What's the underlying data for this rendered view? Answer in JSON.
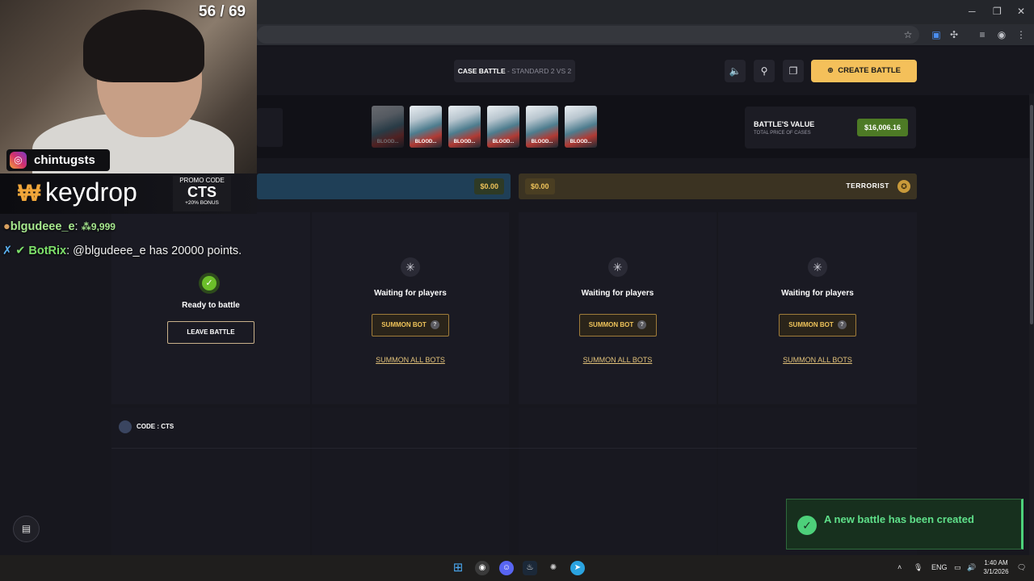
{
  "stream": {
    "counter": "56 / 69",
    "instagram_handle": "chintugsts",
    "sponsor_logo": "keydrop",
    "promo_label": "PROMO CODE",
    "promo_code": "CTS",
    "promo_bonus": "+20% BONUS",
    "chat": [
      {
        "user": "blgudeee_e",
        "sep": ":",
        "points": "9,999"
      },
      {
        "user": "BotRix",
        "sep": ":",
        "text": " @blgudeee_e has 20000 points."
      }
    ]
  },
  "header": {
    "mode_label": "CASE BATTLE",
    "mode_sub": " - STANDARD 2 VS 2",
    "create_button": "CREATE BATTLE",
    "icons": [
      "sound-icon",
      "link-icon",
      "copy-icon"
    ]
  },
  "cases": {
    "label": "BLOOD...",
    "count": 6,
    "battle_value_title": "BATTLE'S VALUE",
    "battle_value_sub": "TOTAL PRICE OF CASES",
    "battle_value": "$16,006.16"
  },
  "teams": {
    "ct": {
      "amount": "$0.00"
    },
    "t": {
      "amount": "$0.00",
      "name": "TERRORIST"
    }
  },
  "slots": {
    "ready_text": "Ready to battle",
    "leave_button": "LEAVE BATTLE",
    "waiting_text": "Waiting for players",
    "summon_bot": "SUMMON BOT",
    "summon_all": "SUMMON ALL BOTS"
  },
  "player": {
    "code_label": "CODE : CTS"
  },
  "toast": {
    "message": "A new battle has been created"
  },
  "taskbar": {
    "lang": "ENG",
    "time": "1:40 AM",
    "date": "3/1/2026"
  },
  "colors": {
    "accent": "#f4c05a",
    "success": "#4dd07a",
    "value_green": "#4d7a25"
  }
}
